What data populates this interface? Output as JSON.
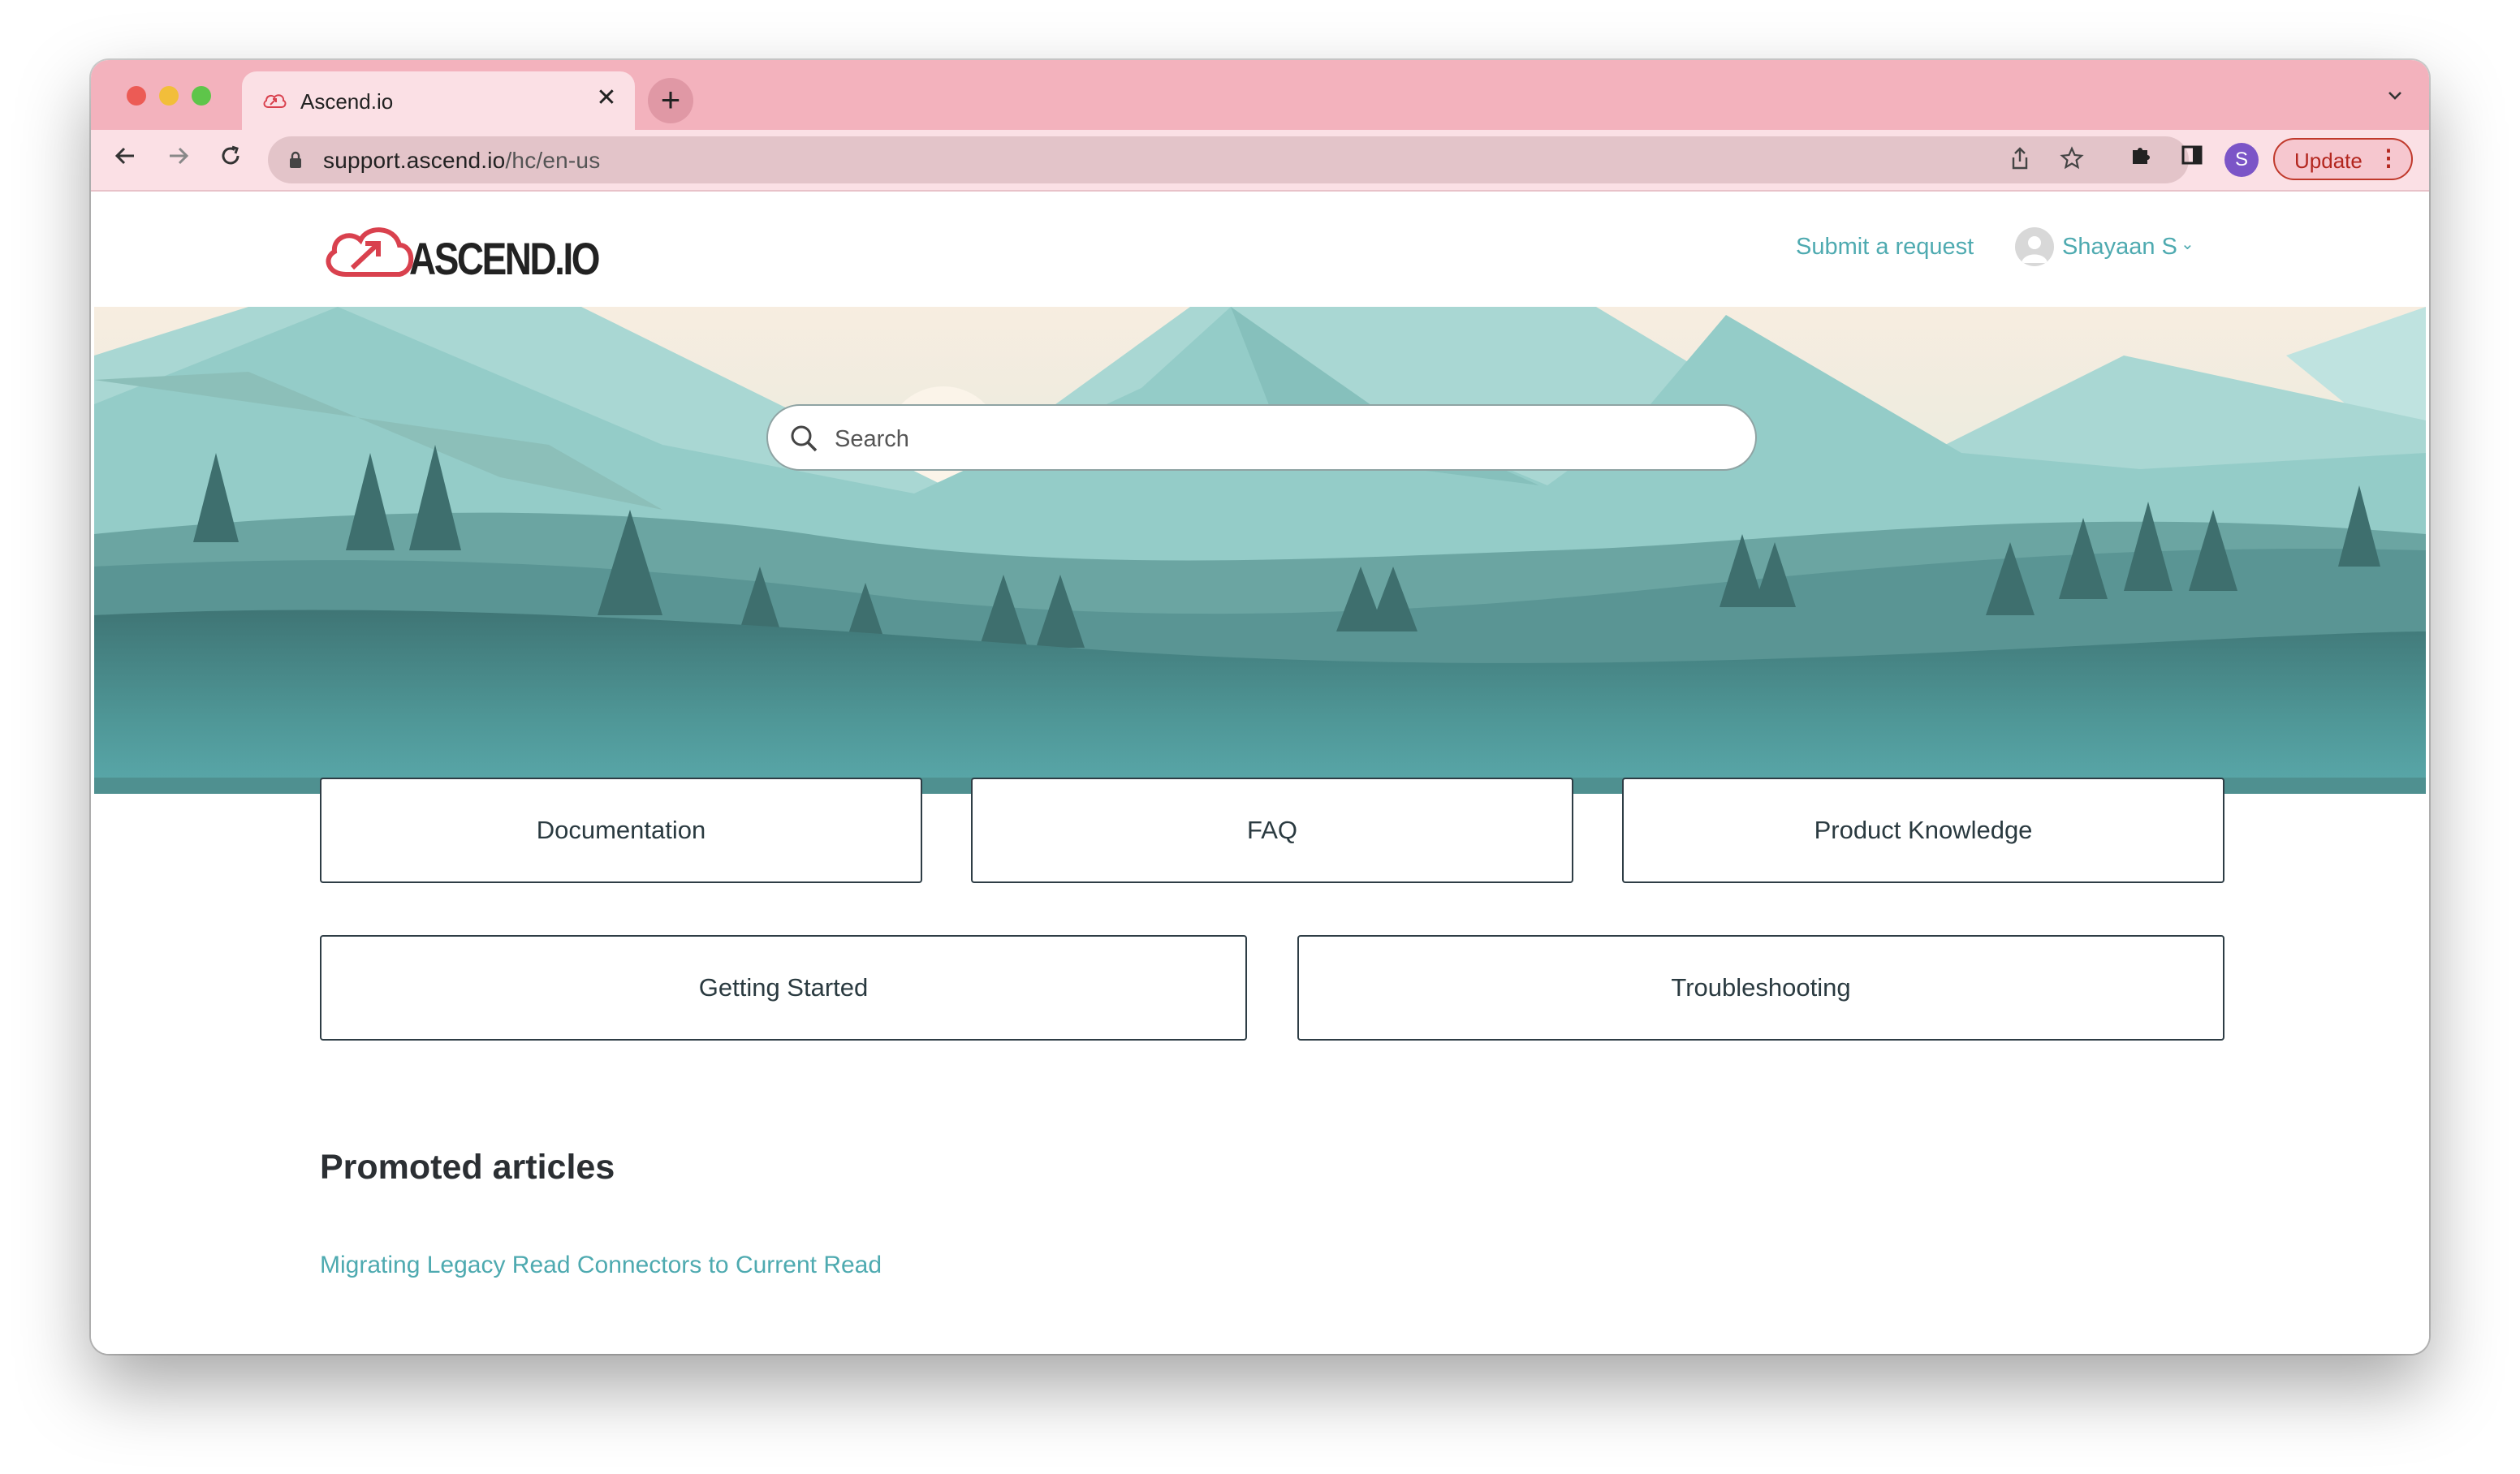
{
  "browser": {
    "tab_title": "Ascend.io",
    "tab_close": "✕",
    "new_tab": "+",
    "tab_list_icon": "chevron-down-icon",
    "url_host": "support.ascend.io",
    "url_path": "/hc/en-us",
    "profile_initial": "S",
    "update_label": "Update",
    "update_menu": "⋮",
    "colors": {
      "tabbar": "#f3b2bd",
      "toolbar": "#fbe0e5",
      "profile": "#7b55c7"
    }
  },
  "header": {
    "logo_text": "ASCEND.IO",
    "submit_request": "Submit a request",
    "user_name": "Shayaan S",
    "user_caret": "⌄"
  },
  "hero": {
    "search_placeholder": "Search"
  },
  "categories": [
    {
      "label": "Documentation"
    },
    {
      "label": "FAQ"
    },
    {
      "label": "Product Knowledge"
    },
    {
      "label": "Getting Started"
    },
    {
      "label": "Troubleshooting"
    }
  ],
  "promoted": {
    "title": "Promoted articles",
    "articles": [
      {
        "label": "Migrating Legacy Read Connectors to Current Read"
      }
    ]
  },
  "accent_color": "#4eaab0"
}
